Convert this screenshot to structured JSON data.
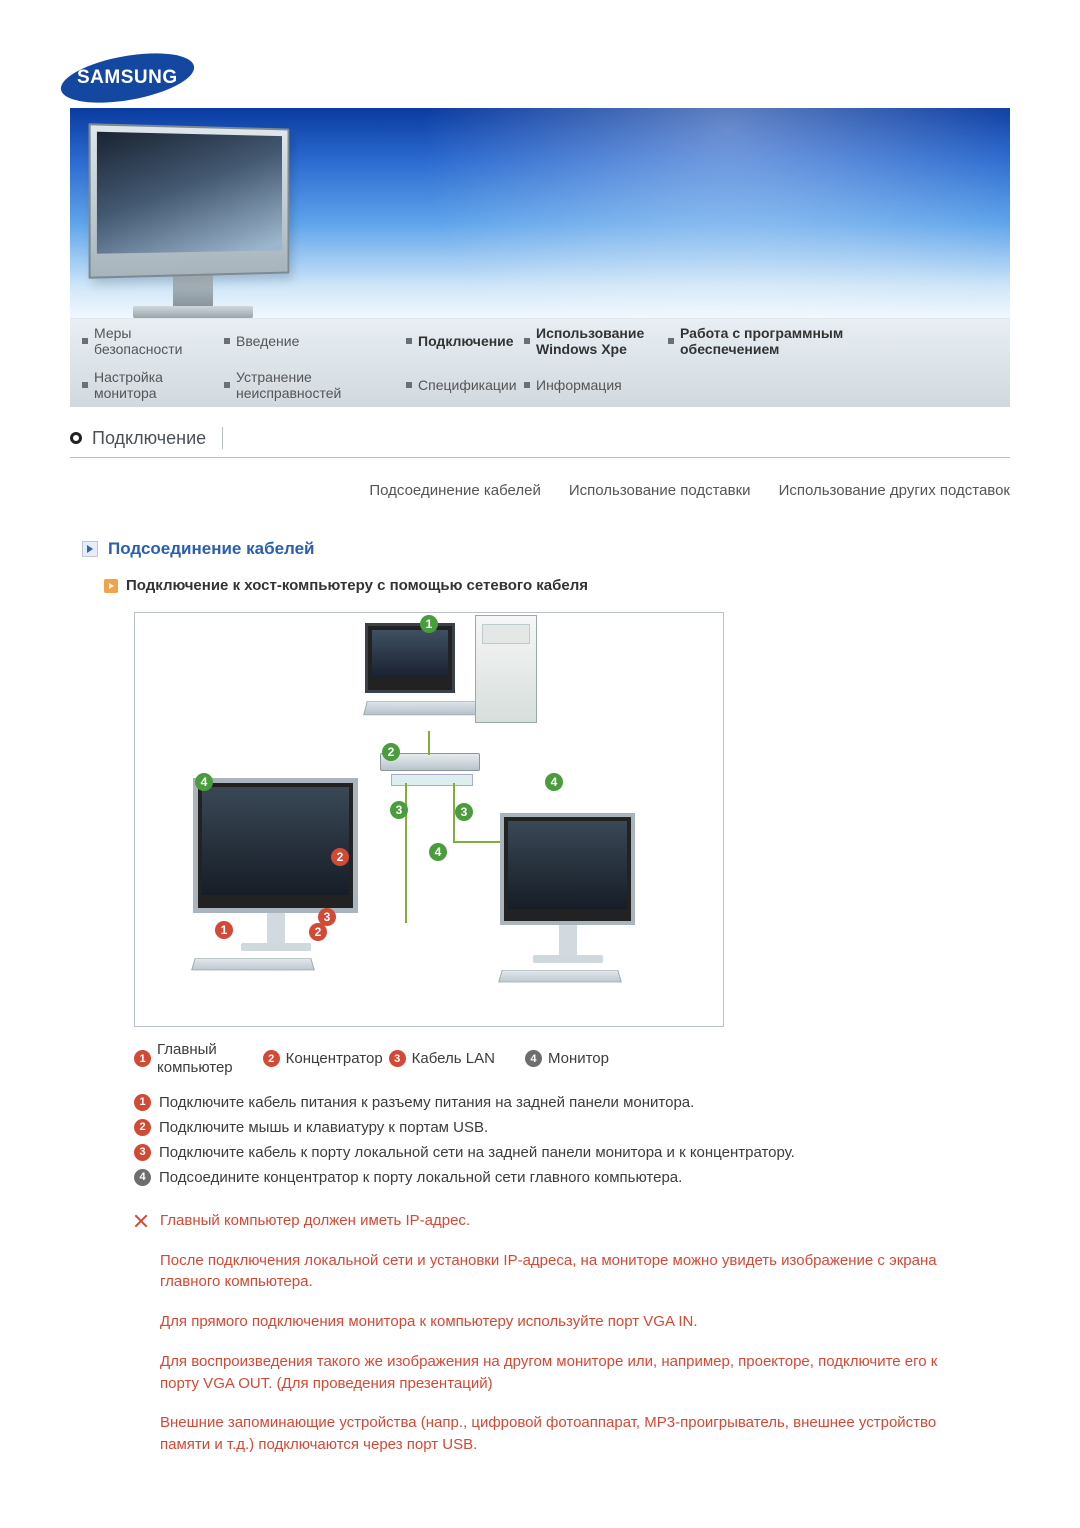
{
  "logo_text": "SAMSUNG",
  "nav": {
    "row1": {
      "c1": "Меры безопасности",
      "c2": "Введение",
      "c3": "Подключение",
      "c4a": "Использование",
      "c4b": "Windows Xpe",
      "c5a": "Работа с программным",
      "c5b": "обеспечением"
    },
    "row2": {
      "c1": "Настройка монитора",
      "c2": "Устранение неисправностей",
      "c3": "Спецификации",
      "c4": "Информация"
    }
  },
  "section_title": "Подключение",
  "subtabs": {
    "a": "Подсоединение кабелей",
    "b": "Использование подставки",
    "c": "Использование других подставок"
  },
  "heading_cables": "Подсоединение кабелей",
  "subheading": "Подключение к хост-компьютеру с помощью сетевого кабеля",
  "legend": {
    "l1a": "Главный",
    "l1b": "компьютер",
    "l2": "Концентратор",
    "l3": "Кабель LAN",
    "l4": "Монитор"
  },
  "steps": {
    "s1": "Подключите кабель питания к разъему питания на задней панели монитора.",
    "s2": "Подключите мышь и клавиатуру к портам USB.",
    "s3": "Подключите кабель к порту локальной сети на задней панели монитора и к концентратору.",
    "s4": "Подсоедините концентратор к порту локальной сети главного компьютера."
  },
  "notes": {
    "n1": "Главный компьютер должен иметь IP-адрес.",
    "n2": "После подключения локальной сети и установки IP-адреса, на мониторе можно увидеть изображение с экрана главного компьютера.",
    "n3": "Для прямого подключения монитора к компьютеру используйте порт VGA IN.",
    "n4": "Для воспроизведения такого же изображения на другом мониторе или, например, проекторе, подключите его к порту VGA OUT. (Для проведения презентаций)",
    "n5": "Внешние запоминающие устройства (напр., цифровой фотоаппарат, MP3-проигрыватель, внешнее устройство памяти и т.д.) подключаются через порт USB."
  },
  "badge_nums": {
    "n1": "1",
    "n2": "2",
    "n3": "3",
    "n4": "4"
  }
}
